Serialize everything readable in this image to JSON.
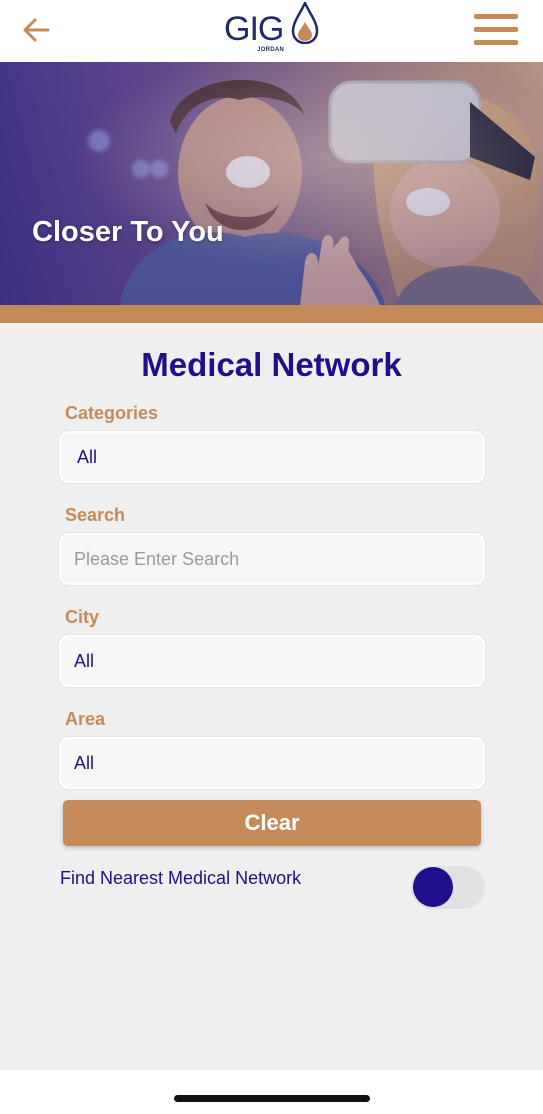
{
  "header": {
    "back_icon": "arrow-left-icon",
    "logo_text": "GIG",
    "logo_subtext": "JORDAN",
    "menu_icon": "hamburger-menu-icon"
  },
  "hero": {
    "title": "Closer To You"
  },
  "page": {
    "title": "Medical Network"
  },
  "form": {
    "categories": {
      "label": "Categories",
      "value": "All"
    },
    "search": {
      "label": "Search",
      "placeholder": "Please Enter Search",
      "value": ""
    },
    "city": {
      "label": "City",
      "value": "All"
    },
    "area": {
      "label": "Area",
      "value": "All"
    },
    "clear_label": "Clear",
    "nearest_label": "Find Nearest Medical Network",
    "nearest_enabled": false
  },
  "colors": {
    "accent": "#c58a5a",
    "primary": "#1f0f8a",
    "background": "#efefef"
  }
}
